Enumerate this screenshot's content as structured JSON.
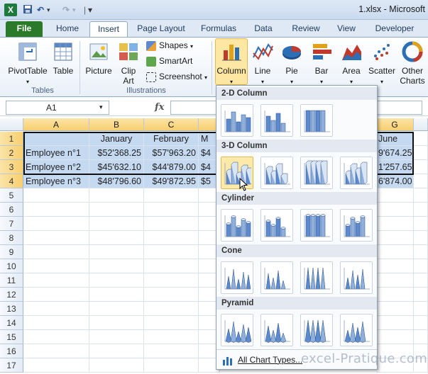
{
  "window": {
    "app_icon": "X",
    "title": "1.xlsx - Microsoft",
    "qat_undo": "↶",
    "qat_redo": "↷",
    "qat_more": "▾"
  },
  "tabs": [
    "File",
    "Home",
    "Insert",
    "Page Layout",
    "Formulas",
    "Data",
    "Review",
    "View",
    "Developer"
  ],
  "active_tab": "Insert",
  "ribbon": {
    "pivottable": "PivotTable",
    "table": "Table",
    "picture": "Picture",
    "clip_art": "Clip Art",
    "shapes": "Shapes",
    "smartart": "SmartArt",
    "screenshot": "Screenshot",
    "column": "Column",
    "line": "Line",
    "pie": "Pie",
    "bar": "Bar",
    "area": "Area",
    "scatter": "Scatter",
    "other_charts": "Other Charts",
    "group_tables": "Tables",
    "group_illustrations": "Illustrations"
  },
  "formula_bar": {
    "name_box": "A1",
    "fx": "fx",
    "formula": ""
  },
  "sheet": {
    "columns": [
      "A",
      "B",
      "C",
      "G"
    ],
    "rows": [
      "1",
      "2",
      "3",
      "4",
      "5",
      "6",
      "7",
      "8",
      "9",
      "10",
      "11",
      "12",
      "13",
      "14",
      "15",
      "16",
      "17"
    ],
    "header_row": [
      "",
      "January",
      "February",
      "June"
    ],
    "data": [
      [
        "Employee n°1",
        "$52'368.25",
        "$57'963.20",
        "$4",
        "9'674.25"
      ],
      [
        "Employee n°2",
        "$45'632.10",
        "$44'879.00",
        "$4",
        "1'257.65"
      ],
      [
        "Employee n°3",
        "$48'796.60",
        "$49'872.95",
        "$5",
        "6'874.00"
      ]
    ],
    "partial_header_d": "M"
  },
  "dropdown": {
    "sections": [
      "2-D Column",
      "3-D Column",
      "Cylinder",
      "Cone",
      "Pyramid"
    ],
    "all_chart_types": "All Chart Types...",
    "hovered": "3-D Clustered Column"
  },
  "watermark": "excel-Pratique.com",
  "colors": {
    "selection_fill": "#c5d9f1",
    "file_tab": "#2a7a2a",
    "hover": "#fde9a9"
  }
}
